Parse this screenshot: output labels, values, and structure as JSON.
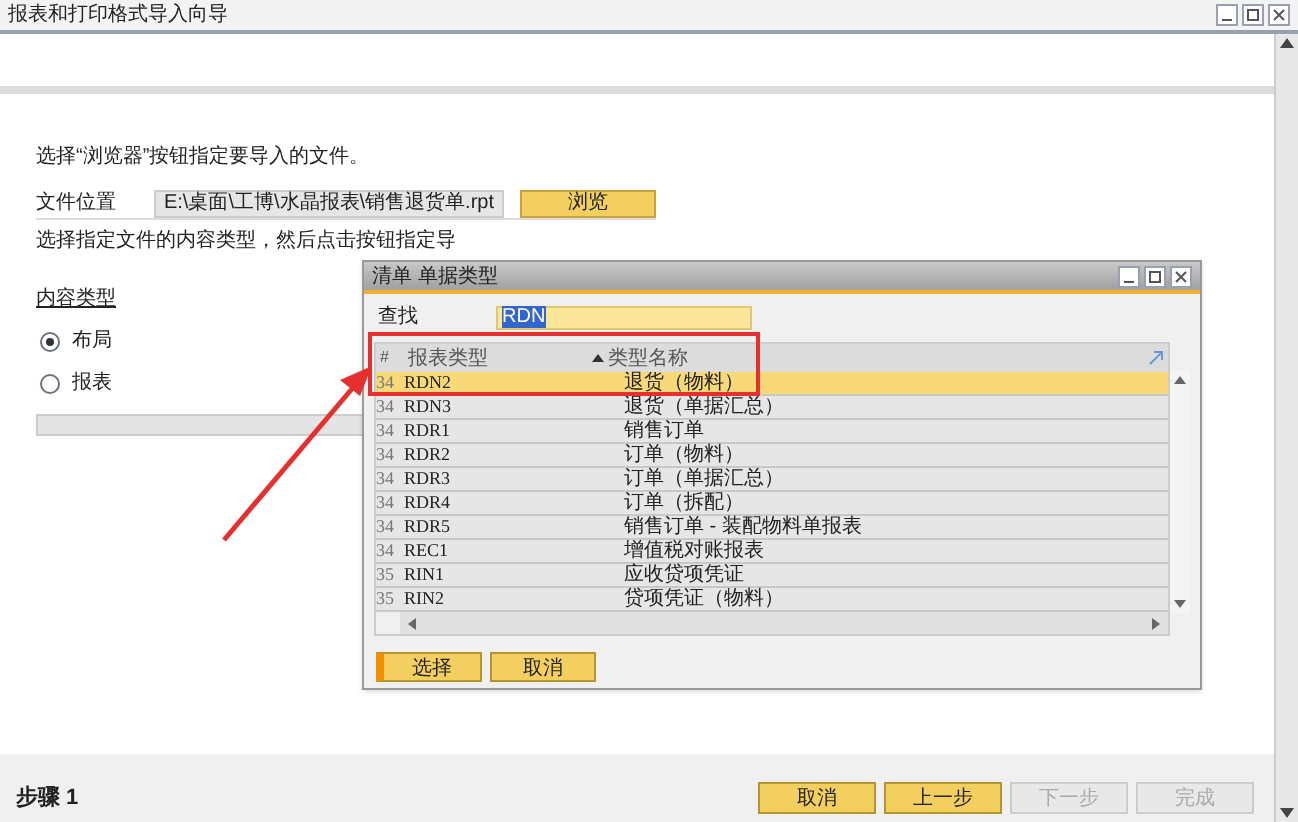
{
  "window": {
    "title": "报表和打印格式导入向导"
  },
  "instruction": "选择“浏览器”按钮指定要导入的文件。",
  "file_location": {
    "label": "文件位置",
    "value": "E:\\桌面\\工博\\水晶报表\\销售退货单.rpt",
    "browse_button": "浏览"
  },
  "content_instruction": "选择指定文件的内容类型，然后点击按钮指定导",
  "content_type": {
    "label": "内容类型",
    "options": [
      {
        "label": "布局",
        "selected": true
      },
      {
        "label": "报表",
        "selected": false
      }
    ]
  },
  "dialog": {
    "title": "清单 单据类型",
    "search": {
      "label": "查找",
      "value": "RDN"
    },
    "columns": [
      "#",
      "报表类型",
      "类型名称"
    ],
    "rows": [
      {
        "num": "34",
        "code": "RDN2",
        "name": "退货（物料）",
        "selected": true
      },
      {
        "num": "34",
        "code": "RDN3",
        "name": "退货（单据汇总）",
        "selected": false
      },
      {
        "num": "34",
        "code": "RDR1",
        "name": "销售订单",
        "selected": false
      },
      {
        "num": "34",
        "code": "RDR2",
        "name": "订单（物料）",
        "selected": false
      },
      {
        "num": "34",
        "code": "RDR3",
        "name": "订单（单据汇总）",
        "selected": false
      },
      {
        "num": "34",
        "code": "RDR4",
        "name": "订单（拆配）",
        "selected": false
      },
      {
        "num": "34",
        "code": "RDR5",
        "name": "销售订单 - 装配物料单报表",
        "selected": false
      },
      {
        "num": "34",
        "code": "REC1",
        "name": "增值税对账报表",
        "selected": false
      },
      {
        "num": "35",
        "code": "RIN1",
        "name": "应收贷项凭证",
        "selected": false
      },
      {
        "num": "35",
        "code": "RIN2",
        "name": "贷项凭证（物料）",
        "selected": false
      }
    ],
    "buttons": [
      {
        "label": "选择",
        "focused": true
      },
      {
        "label": "取消",
        "focused": false
      }
    ]
  },
  "footer": {
    "step": "步骤 1",
    "buttons": [
      {
        "label": "取消",
        "disabled": false
      },
      {
        "label": "上一步",
        "disabled": false
      },
      {
        "label": "下一步",
        "disabled": true
      },
      {
        "label": "完成",
        "disabled": true
      }
    ]
  }
}
